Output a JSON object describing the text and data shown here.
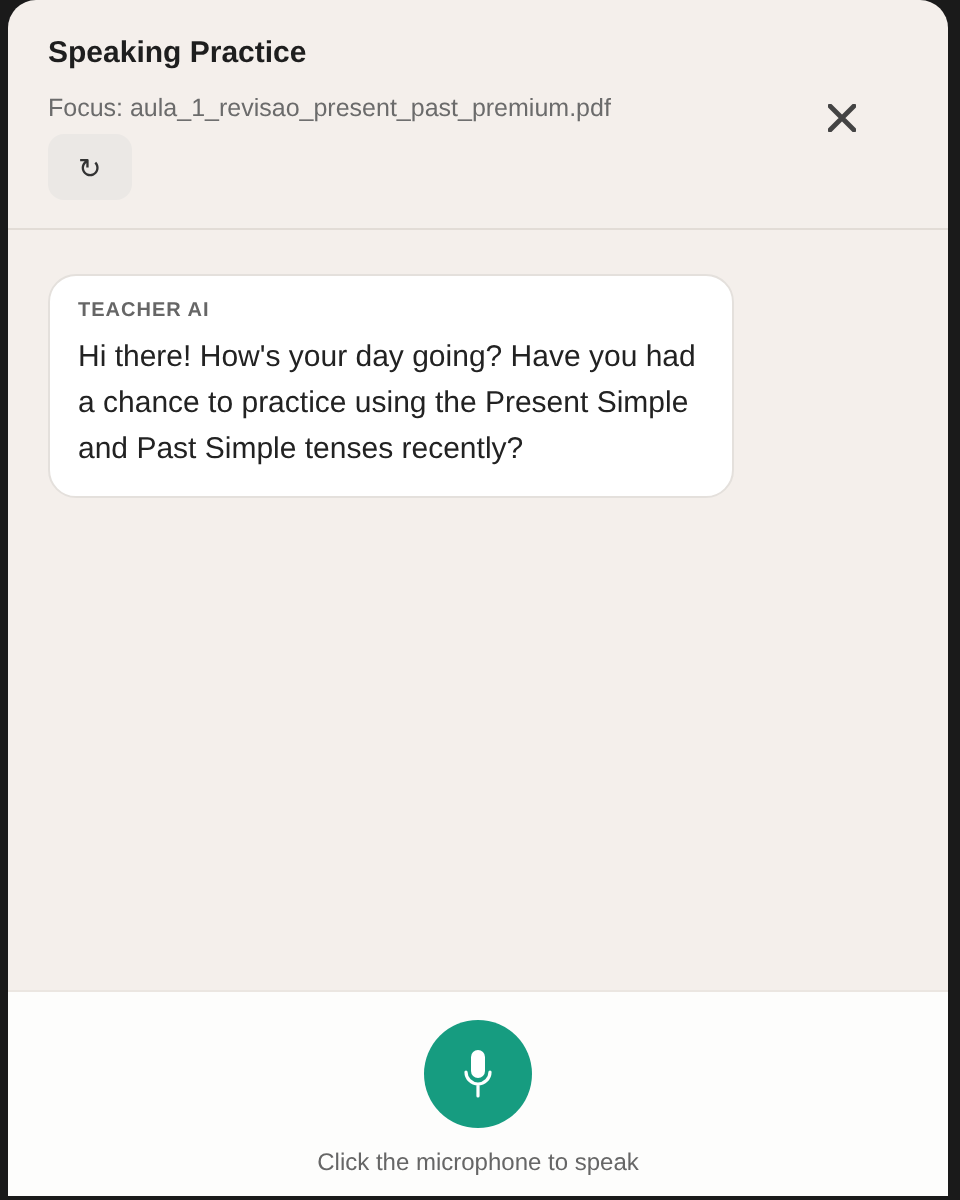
{
  "header": {
    "title": "Speaking Practice",
    "focus": "Focus: aula_1_revisao_present_past_premium.pdf",
    "reset_symbol": "↻"
  },
  "messages": [
    {
      "sender": "TEACHER AI",
      "text": "Hi there! How's your day going? Have you had a chance to practice using the Present Simple and Past Simple tenses recently?"
    }
  ],
  "footer": {
    "hint": "Click the microphone to speak"
  }
}
